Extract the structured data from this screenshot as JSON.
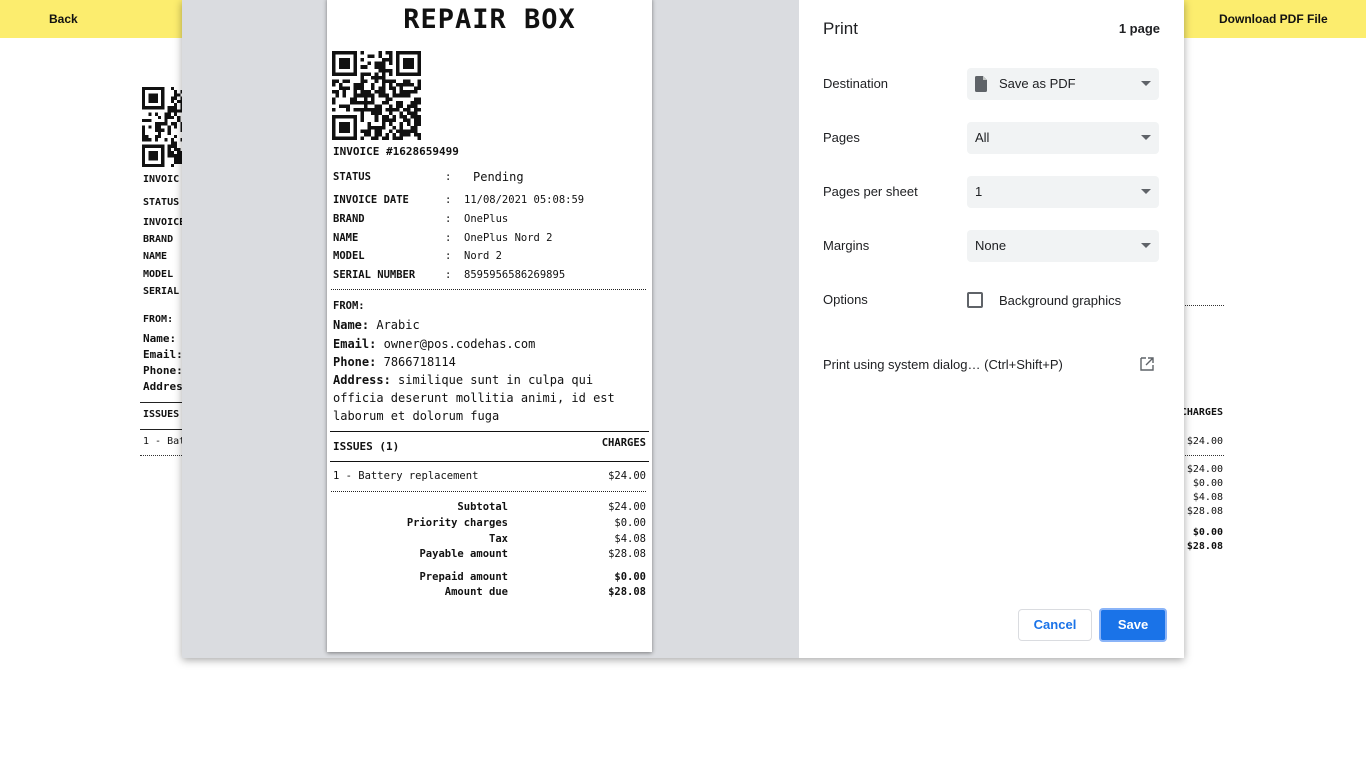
{
  "page": {
    "back_label": "Back",
    "download_label": "Download PDF File"
  },
  "background_invoice": {
    "labels": [
      "INVOIC",
      "STATUS",
      "INVOICE",
      "BRAND",
      "NAME",
      "MODEL",
      "SERIAL",
      "FROM:",
      "Name:",
      "Email:",
      "Phone:",
      "Addres",
      "ISSUES",
      "1 - Bat"
    ],
    "charges_header": "CHARGES",
    "issue_amount": "$24.00",
    "totals": [
      "$24.00",
      "$0.00",
      "$4.08",
      "$28.08"
    ],
    "due_totals": [
      "$0.00",
      "$28.08"
    ]
  },
  "receipt": {
    "title": "REPAIR BOX",
    "invoice_number": "INVOICE #1628659499",
    "fields": [
      {
        "key": "STATUS",
        "value": "Pending"
      },
      {
        "key": "INVOICE DATE",
        "value": "11/08/2021 05:08:59"
      },
      {
        "key": "BRAND",
        "value": "OnePlus"
      },
      {
        "key": "NAME",
        "value": "OnePlus Nord 2"
      },
      {
        "key": "MODEL",
        "value": "Nord 2"
      },
      {
        "key": "SERIAL NUMBER",
        "value": "8595956586269895"
      }
    ],
    "separator": ":",
    "from_label": "FROM:",
    "from": {
      "name_label": "Name:",
      "name": "Arabic",
      "email_label": "Email:",
      "email": "owner@pos.codehas.com",
      "phone_label": "Phone:",
      "phone": "7866718114",
      "address_label": "Address:",
      "address": "similique sunt in culpa qui officia deserunt mollitia animi, id est laborum et dolorum fuga"
    },
    "issues_header": "ISSUES (1)",
    "charges_header": "CHARGES",
    "issues": [
      {
        "label": "1 - Battery replacement",
        "amount": "$24.00"
      }
    ],
    "totals": [
      {
        "label": "Subtotal",
        "value": "$24.00"
      },
      {
        "label": "Priority charges",
        "value": "$0.00"
      },
      {
        "label": "Tax",
        "value": "$4.08"
      },
      {
        "label": "Payable amount",
        "value": "$28.08"
      }
    ],
    "due": [
      {
        "label": "Prepaid amount",
        "value": "$0.00"
      },
      {
        "label": "Amount due",
        "value": "$28.08"
      }
    ]
  },
  "print_panel": {
    "title": "Print",
    "page_count": "1 page",
    "destination_label": "Destination",
    "destination_value": "Save as PDF",
    "pages_label": "Pages",
    "pages_value": "All",
    "pages_per_sheet_label": "Pages per sheet",
    "pages_per_sheet_value": "1",
    "margins_label": "Margins",
    "margins_value": "None",
    "options_label": "Options",
    "background_graphics_label": "Background graphics",
    "background_graphics_checked": false,
    "system_dialog_label": "Print using system dialog… (Ctrl+Shift+P)",
    "cancel_label": "Cancel",
    "save_label": "Save",
    "accent_color": "#1a73e8"
  },
  "colors": {
    "topbar": "#fced6e",
    "preview_bg": "#dadce0"
  }
}
